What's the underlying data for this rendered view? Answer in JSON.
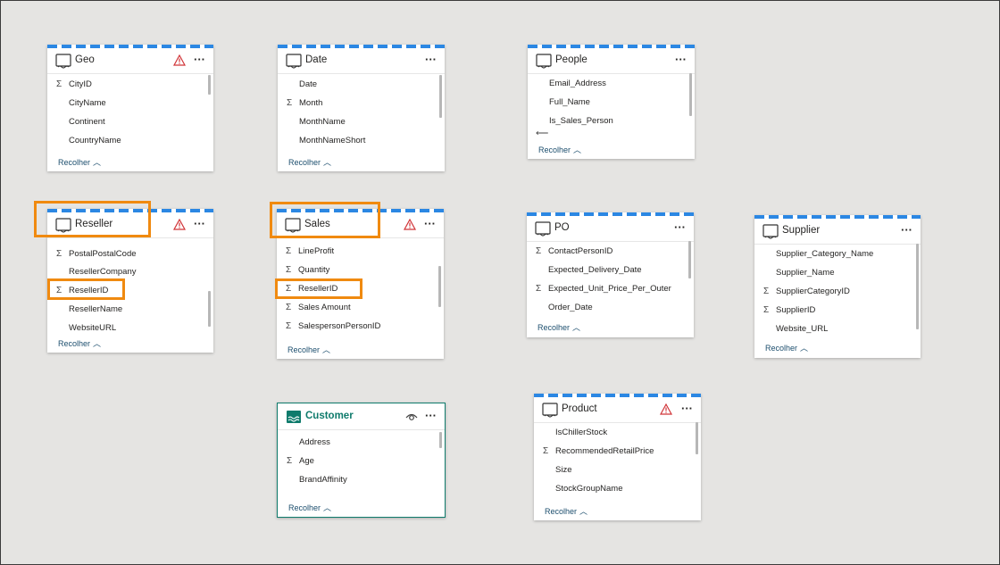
{
  "collapse_label": "Recolher",
  "tables": [
    {
      "id": "geo",
      "title": "Geo",
      "warning": true,
      "fields": [
        {
          "sigma": true,
          "name": "CityID"
        },
        {
          "sigma": false,
          "name": "CityName"
        },
        {
          "sigma": false,
          "name": "Continent"
        },
        {
          "sigma": false,
          "name": "CountryName"
        }
      ]
    },
    {
      "id": "date",
      "title": "Date",
      "warning": false,
      "fields": [
        {
          "sigma": false,
          "name": "Date"
        },
        {
          "sigma": true,
          "name": "Month"
        },
        {
          "sigma": false,
          "name": "MonthName"
        },
        {
          "sigma": false,
          "name": "MonthNameShort"
        }
      ]
    },
    {
      "id": "people",
      "title": "People",
      "warning": false,
      "fields": [
        {
          "sigma": false,
          "name": "Email_Address"
        },
        {
          "sigma": false,
          "name": "Full_Name"
        },
        {
          "sigma": false,
          "name": "Is_Sales_Person"
        }
      ]
    },
    {
      "id": "reseller",
      "title": "Reseller",
      "warning": true,
      "highlighted": true,
      "fields": [
        {
          "sigma": true,
          "name": "PostalPostalCode"
        },
        {
          "sigma": false,
          "name": "ResellerCompany"
        },
        {
          "sigma": true,
          "name": "ResellerID",
          "highlighted": true
        },
        {
          "sigma": false,
          "name": "ResellerName"
        },
        {
          "sigma": false,
          "name": "WebsiteURL"
        }
      ]
    },
    {
      "id": "sales",
      "title": "Sales",
      "warning": true,
      "highlighted": true,
      "fields": [
        {
          "sigma": true,
          "name": "LineProfit"
        },
        {
          "sigma": true,
          "name": "Quantity"
        },
        {
          "sigma": true,
          "name": "ResellerID",
          "highlighted": true
        },
        {
          "sigma": true,
          "name": "Sales Amount"
        },
        {
          "sigma": true,
          "name": "SalespersonPersonID"
        }
      ]
    },
    {
      "id": "po",
      "title": "PO",
      "warning": false,
      "fields": [
        {
          "sigma": true,
          "name": "ContactPersonID"
        },
        {
          "sigma": false,
          "name": "Expected_Delivery_Date"
        },
        {
          "sigma": true,
          "name": "Expected_Unit_Price_Per_Outer"
        },
        {
          "sigma": false,
          "name": "Order_Date"
        }
      ]
    },
    {
      "id": "supplier",
      "title": "Supplier",
      "warning": false,
      "fields": [
        {
          "sigma": false,
          "name": "Supplier_Category_Name"
        },
        {
          "sigma": false,
          "name": "Supplier_Name"
        },
        {
          "sigma": true,
          "name": "SupplierCategoryID"
        },
        {
          "sigma": true,
          "name": "SupplierID"
        },
        {
          "sigma": false,
          "name": "Website_URL"
        }
      ]
    },
    {
      "id": "customer",
      "title": "Customer",
      "warning": false,
      "selected": true,
      "fields": [
        {
          "sigma": false,
          "name": "Address"
        },
        {
          "sigma": true,
          "name": "Age"
        },
        {
          "sigma": false,
          "name": "BrandAffinity"
        }
      ]
    },
    {
      "id": "product",
      "title": "Product",
      "warning": true,
      "fields": [
        {
          "sigma": false,
          "name": "IsChillerStock"
        },
        {
          "sigma": true,
          "name": "RecommendedRetailPrice"
        },
        {
          "sigma": false,
          "name": "Size"
        },
        {
          "sigma": false,
          "name": "StockGroupName"
        }
      ]
    }
  ],
  "icons": {
    "table": "table-icon",
    "warning": "warning-icon",
    "more": "more-options-icon",
    "sigma": "sigma-icon",
    "eye": "eye-icon",
    "chevron": "chevron-up-icon"
  },
  "colors": {
    "accent_stripe": "#2b87e3",
    "highlight": "#f08a10",
    "selected": "#0f7b6c",
    "warning": "#d13438",
    "canvas": "#e5e4e2"
  }
}
